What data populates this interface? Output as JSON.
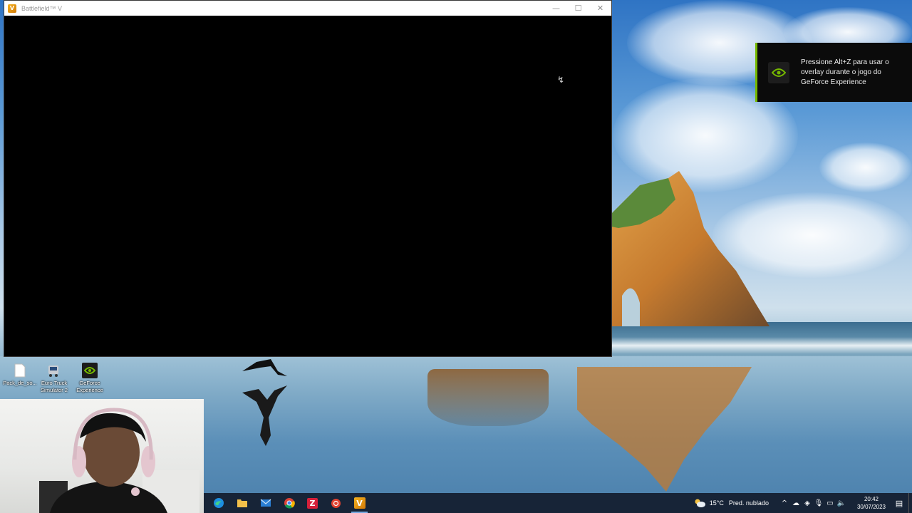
{
  "window": {
    "title": "Battlefield™ V",
    "minimize_glyph": "—",
    "maximize_glyph": "☐",
    "close_glyph": "✕"
  },
  "desktop_icons": [
    {
      "label": "Pack_de_so...",
      "icon": "file-icon"
    },
    {
      "label": "Euro Truck Simulator 2",
      "icon": "truck-icon"
    },
    {
      "label": "GeForce Experience",
      "icon": "nvidia-icon"
    }
  ],
  "notification": {
    "text": "Pressione Alt+Z para usar o overlay durante o jogo do GeForce Experience",
    "icon": "nvidia-icon",
    "accent": "#76b900"
  },
  "taskbar": {
    "apps": [
      {
        "name": "edge",
        "icon": "edge-icon"
      },
      {
        "name": "file-explorer",
        "icon": "folder-icon"
      },
      {
        "name": "mail",
        "icon": "mail-icon"
      },
      {
        "name": "chrome",
        "icon": "chrome-icon"
      },
      {
        "name": "z-app",
        "icon": "z-icon",
        "glyph": "Z"
      },
      {
        "name": "red-app",
        "icon": "red-circle-icon"
      },
      {
        "name": "battlefield",
        "icon": "battlefield-icon",
        "glyph": "V",
        "active": true
      }
    ],
    "weather": {
      "temp": "15°C",
      "desc": "Pred. nublado",
      "icon": "cloud-sun-icon"
    },
    "tray": [
      {
        "icon": "chevron-up-icon",
        "glyph": "^"
      },
      {
        "icon": "onedrive-icon",
        "glyph": "☁"
      },
      {
        "icon": "gpu-icon",
        "glyph": "◈"
      },
      {
        "icon": "microphone-icon",
        "glyph": "🎙"
      },
      {
        "icon": "network-icon",
        "glyph": "▭"
      },
      {
        "icon": "volume-icon",
        "glyph": "🔈"
      }
    ],
    "clock": {
      "time": "20:42",
      "date": "30/07/2023"
    },
    "notifications_glyph": "▤"
  }
}
